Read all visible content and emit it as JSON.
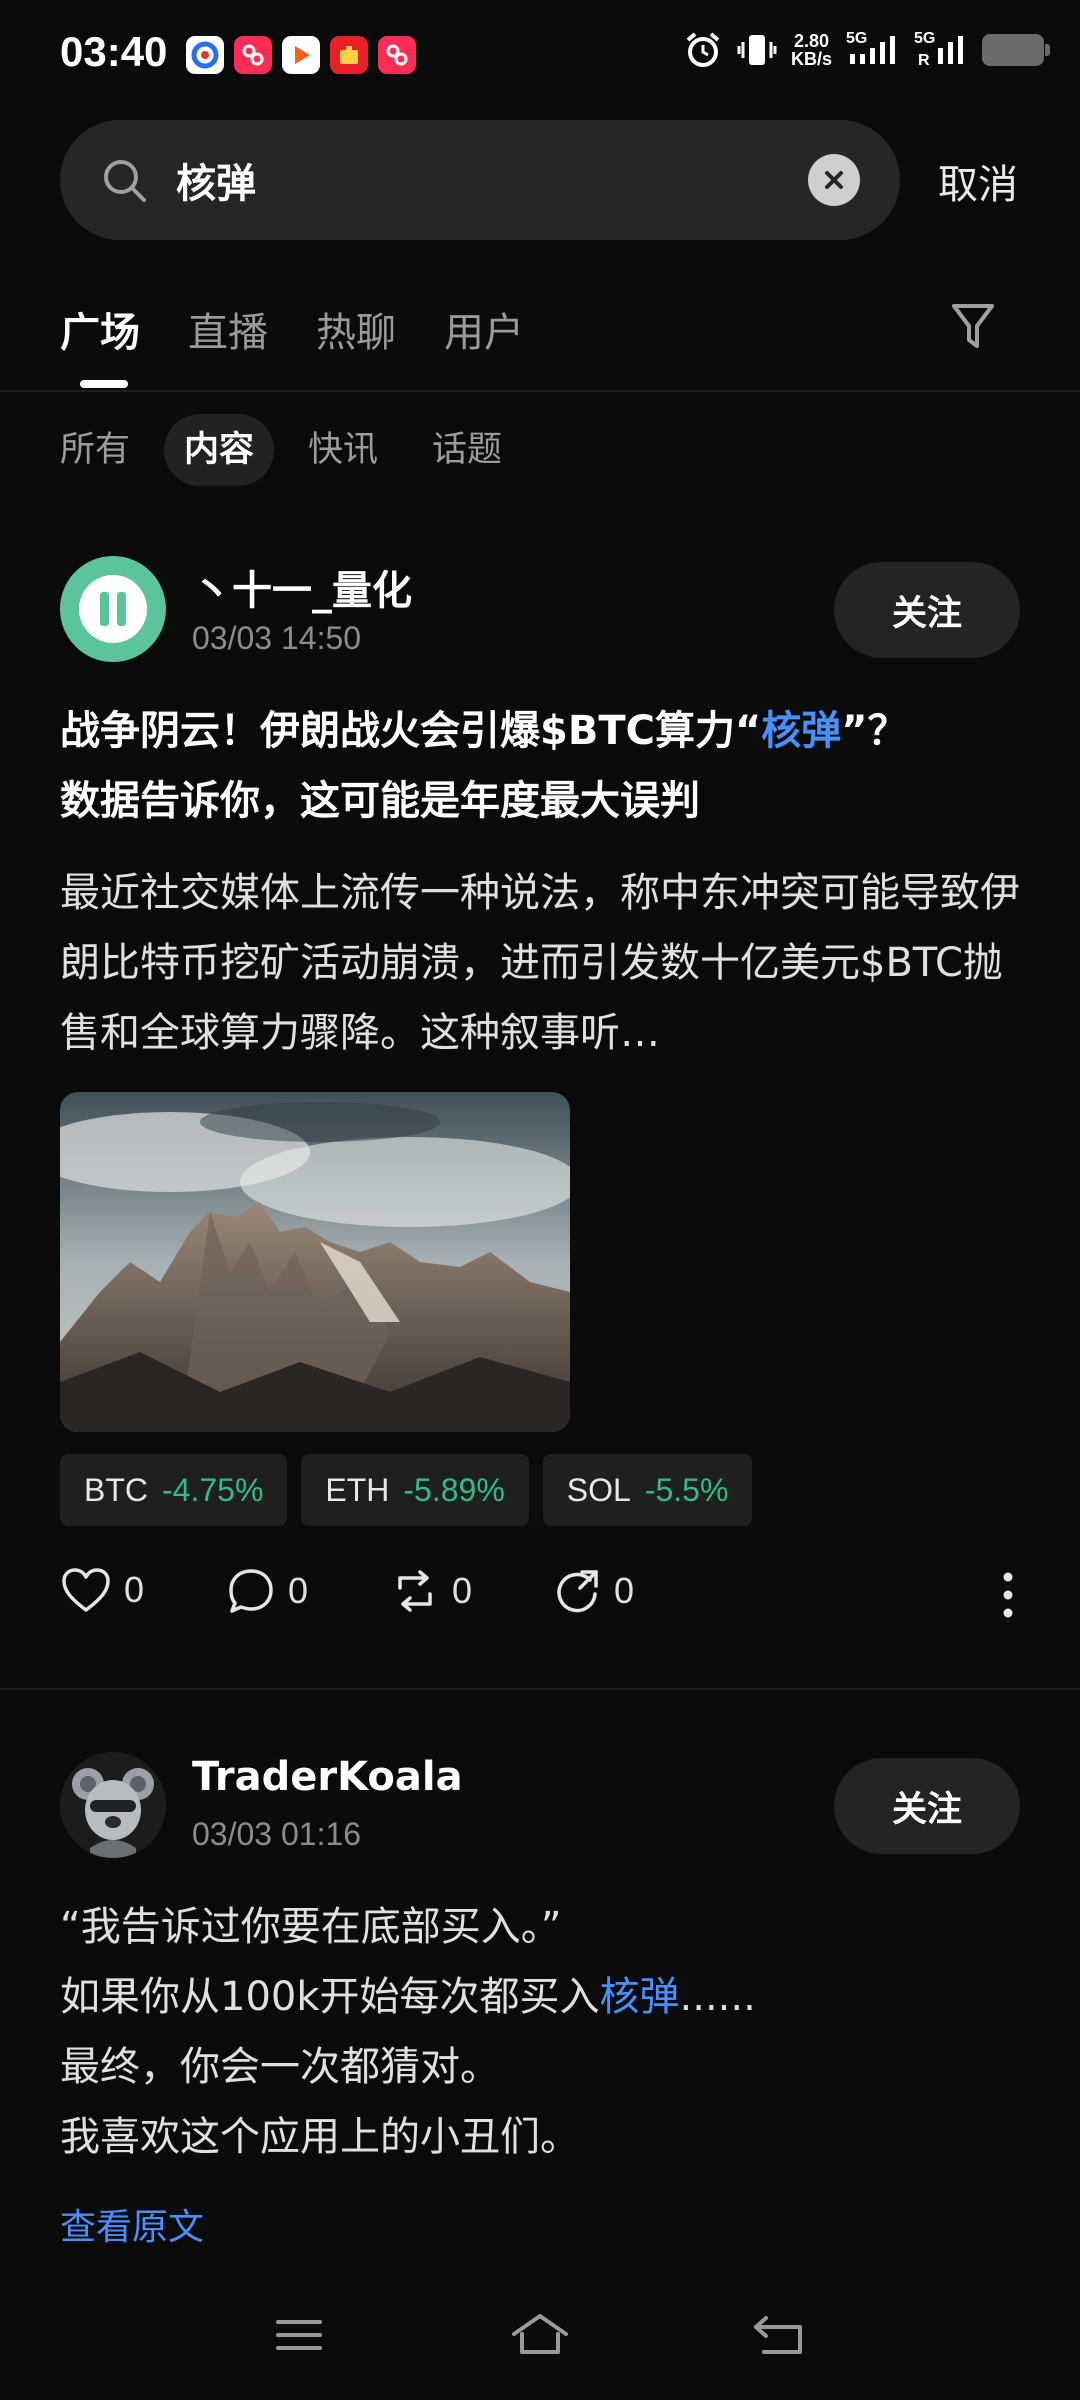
{
  "status_bar": {
    "time": "03:40",
    "net_speed_value": "2.80",
    "net_speed_unit": "KB/s",
    "sig1_label": "5G",
    "sig2_label": "5G",
    "sig2_sub": "R"
  },
  "search": {
    "query": "核弹",
    "cancel_label": "取消"
  },
  "tabs": [
    "广场",
    "直播",
    "热聊",
    "用户"
  ],
  "subtabs": [
    "所有",
    "内容",
    "快讯",
    "话题"
  ],
  "post1": {
    "author": "丶十一_量化",
    "time": "03/03 14:50",
    "follow_label": "关注",
    "title_pre": "战争阴云！伊朗战火会引爆$BTC算力“",
    "title_hl": "核弹",
    "title_post": "”？",
    "title_line2": "数据告诉你，这可能是年度最大误判",
    "body": "最近社交媒体上流传一种说法，称中东冲突可能导致伊朗比特币挖矿活动崩溃，进而引发数十亿美元$BTC抛售和全球算力骤降。这种叙事听…",
    "tickers": [
      {
        "symbol": "BTC",
        "change": "-4.75%"
      },
      {
        "symbol": "ETH",
        "change": "-5.89%"
      },
      {
        "symbol": "SOL",
        "change": "-5.5%"
      }
    ],
    "likes": "0",
    "comments": "0",
    "reposts": "0",
    "shares": "0"
  },
  "post2": {
    "author": "TraderKoala",
    "time": "03/03 01:16",
    "follow_label": "关注",
    "line1": "“我告诉过你要在底部买入。”",
    "line2_pre": "如果你从100k开始每次都买入",
    "line2_hl": "核弹",
    "line2_post": "......",
    "line3": "最终，你会一次都猜对。",
    "line4": "我喜欢这个应用上的小丑们。",
    "view_original": "查看原文"
  },
  "colors": {
    "background": "#0b0b0b",
    "highlight": "#4a8fff",
    "negative_change": "#2ebd85"
  }
}
